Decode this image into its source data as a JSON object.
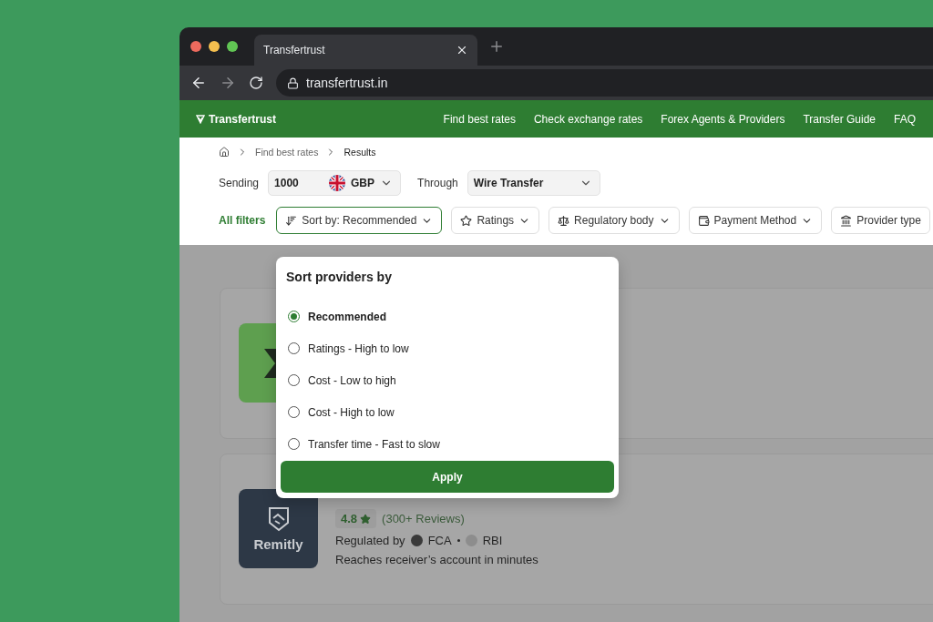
{
  "browser": {
    "tab_title": "Transfertrust",
    "url": "transfertrust.in"
  },
  "nav": {
    "logo": "Transfertrust",
    "links": [
      "Find best rates",
      "Check exchange rates",
      "Forex Agents & Providers",
      "Transfer Guide",
      "FAQ"
    ]
  },
  "breadcrumb": [
    {
      "label": "Find best rates",
      "current": false
    },
    {
      "label": "Results",
      "current": true
    }
  ],
  "search": {
    "sending_label": "Sending",
    "amount": "1000",
    "currency": "GBP",
    "through_label": "Through",
    "method": "Wire Transfer"
  },
  "filters": {
    "all_label": "All filters",
    "chips": [
      {
        "kind": "sort",
        "prefix": "Sort by:",
        "label": "Recommended",
        "active": true
      },
      {
        "kind": "ratings",
        "label": "Ratings",
        "active": false
      },
      {
        "kind": "regulatory",
        "label": "Regulatory body",
        "active": false
      },
      {
        "kind": "payment",
        "label": "Payment Method",
        "active": false
      },
      {
        "kind": "provider",
        "label": "Provider type",
        "active": false
      }
    ]
  },
  "providers": [
    {
      "logo": {
        "kind": "sigma"
      }
    },
    {
      "logo": {
        "kind": "remitly",
        "text": "Remitly"
      },
      "rating": "4.8",
      "reviews": "(300+ Reviews)",
      "regulated_label": "Regulated by",
      "regulators": [
        "FCA",
        "RBI"
      ],
      "delivery": "Reaches receiver’s account in minutes"
    }
  ],
  "sort_popup": {
    "title": "Sort providers by",
    "options": [
      {
        "label": "Recommended",
        "selected": true
      },
      {
        "label": "Ratings - High to low",
        "selected": false
      },
      {
        "label": "Cost - Low to high",
        "selected": false
      },
      {
        "label": "Cost - High to low",
        "selected": false
      },
      {
        "label": "Transfer time - Fast to slow",
        "selected": false
      }
    ],
    "apply": "Apply"
  }
}
